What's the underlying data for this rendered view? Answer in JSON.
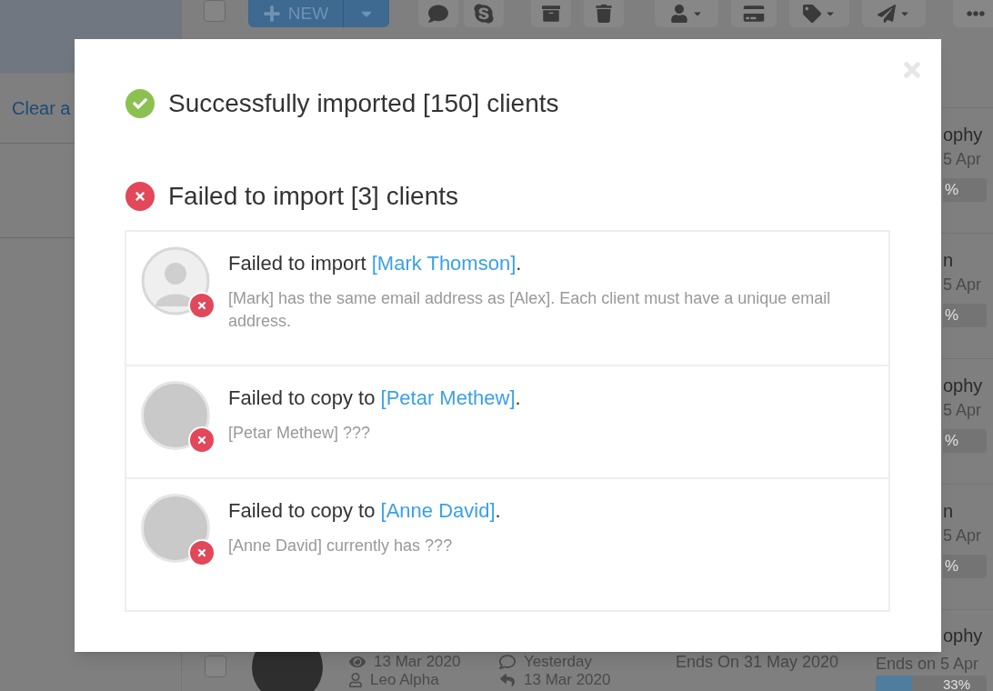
{
  "sidebar": {
    "link": "Clear a"
  },
  "toolbar": {
    "select_all_checked": false,
    "new_button": "NEW"
  },
  "rows": [
    {
      "kind": "partial",
      "title": "ophy",
      "date": "5 Apr",
      "percent": "%"
    },
    {
      "kind": "partial",
      "title": "n",
      "date": "5 Apr",
      "percent": "%"
    },
    {
      "kind": "partial",
      "title": "ophy",
      "date": "5 Apr",
      "percent": "%"
    },
    {
      "kind": "partial",
      "title": "n",
      "date": "5 Apr",
      "percent": "%"
    },
    {
      "kind": "full",
      "checked": false,
      "title": "ophy",
      "viewed": "13 Mar 2020",
      "last_activity": "Yesterday",
      "owner": "Leo Alpha",
      "created": "13 Mar 2020",
      "ends": "Ends On 31 May 2020",
      "date": "Ends on 5 Apr",
      "percent": "33%",
      "level": 0.33
    }
  ],
  "dialog": {
    "success": "Successfully imported [150] clients",
    "failure": "Failed to import [3] clients",
    "errors": [
      {
        "kind": "silhouette",
        "prefix": "Failed to import ",
        "name": "[Mark Thomson]",
        "suffix": ".",
        "detail": "[Mark] has the same email address as [Alex]. Each client must have a unique email address."
      },
      {
        "kind": "photo",
        "prefix": "Failed to copy to ",
        "name": "[Petar Methew]",
        "suffix": ".",
        "detail": "[Petar Methew] ???"
      },
      {
        "kind": "photo",
        "prefix": "Failed to copy to ",
        "name": "[Anne David]",
        "suffix": ".",
        "detail": "[Anne David] currently has ???"
      }
    ]
  }
}
